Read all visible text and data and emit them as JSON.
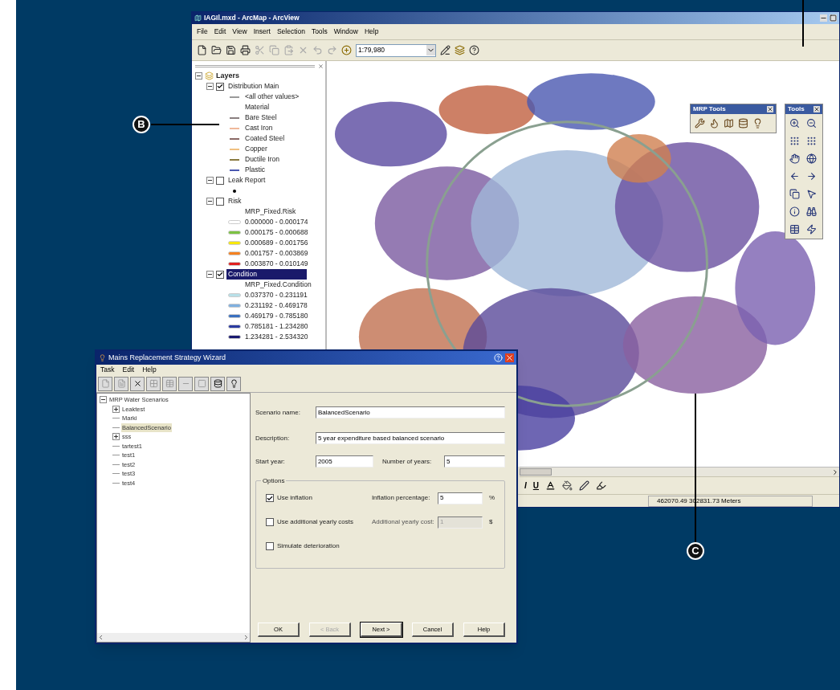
{
  "arcmap": {
    "title": "IAGIl.mxd - ArcMap - ArcView",
    "menu": [
      "File",
      "Edit",
      "View",
      "Insert",
      "Selection",
      "Tools",
      "Window",
      "Help"
    ],
    "scale": "1:79,980",
    "toc": {
      "root": "Layers",
      "expanded": true,
      "layers": [
        {
          "label": "Distribution Main",
          "checked": true,
          "expanded": true,
          "selected": false,
          "legend": [
            {
              "kind": "line",
              "label": "<all other values>",
              "color": "#9a9a9a"
            },
            {
              "kind": "text",
              "label": "Material"
            },
            {
              "kind": "line",
              "label": "Bare Steel",
              "color": "#8a7f80"
            },
            {
              "kind": "line",
              "label": "Cast Iron",
              "color": "#f0b89a"
            },
            {
              "kind": "line",
              "label": "Coated Steel",
              "color": "#8a6a66"
            },
            {
              "kind": "line",
              "label": "Copper",
              "color": "#f0c080"
            },
            {
              "kind": "line",
              "label": "Ductile Iron",
              "color": "#8a7a40"
            },
            {
              "kind": "line",
              "label": "Plastic",
              "color": "#4a58b0"
            }
          ]
        },
        {
          "label": "Leak Report",
          "checked": false,
          "expanded": true,
          "selected": false,
          "legend": [
            {
              "kind": "point",
              "color": "#000000"
            }
          ]
        },
        {
          "label": "Risk",
          "checked": false,
          "expanded": true,
          "selected": false,
          "legend": [
            {
              "kind": "text",
              "label": "MRP_Fixed.Risk"
            },
            {
              "kind": "patch",
              "label": "0.000000 - 0.000174",
              "color": "#ffffff"
            },
            {
              "kind": "patch",
              "label": "0.000175 - 0.000688",
              "color": "#7cc242"
            },
            {
              "kind": "patch",
              "label": "0.000689 - 0.001756",
              "color": "#f7e70a"
            },
            {
              "kind": "patch",
              "label": "0.001757 - 0.003869",
              "color": "#f58220"
            },
            {
              "kind": "patch",
              "label": "0.003870 - 0.010149",
              "color": "#e02020"
            }
          ]
        },
        {
          "label": "Condition",
          "checked": true,
          "expanded": true,
          "selected": true,
          "legend": [
            {
              "kind": "text",
              "label": "MRP_Fixed.Condition"
            },
            {
              "kind": "patch",
              "label": "0.037370 - 0.231191",
              "color": "#b8e0e8"
            },
            {
              "kind": "patch",
              "label": "0.231192 - 0.469178",
              "color": "#80b0e0"
            },
            {
              "kind": "patch",
              "label": "0.469179 - 0.785180",
              "color": "#3a70c0"
            },
            {
              "kind": "patch",
              "label": "0.785181 - 1.234280",
              "color": "#2a3aa0"
            },
            {
              "kind": "patch",
              "label": "1.234281 - 2.534320",
              "color": "#1a1a70"
            }
          ]
        }
      ]
    },
    "toolbars": [
      {
        "title": "MRP Tools"
      },
      {
        "title": "Tools"
      }
    ],
    "format_buttons": [
      "I",
      "U"
    ],
    "status": "462070.49 302831.73 Meters"
  },
  "wizard": {
    "title": "Mains Replacement Strategy Wizard",
    "menu": [
      "Task",
      "Edit",
      "Help"
    ],
    "tree": {
      "label": "MRP Water Scenarios",
      "expanded": true,
      "children": [
        {
          "label": "Leaktest",
          "expanded": false,
          "selected": false
        },
        {
          "label": "Marki",
          "selected": false
        },
        {
          "label": "BalancedScenario",
          "selected": true
        },
        {
          "label": "sss",
          "expanded": false,
          "selected": false
        },
        {
          "label": "tartest1",
          "selected": false
        },
        {
          "label": "test1",
          "selected": false
        },
        {
          "label": "test2",
          "selected": false
        },
        {
          "label": "test3",
          "selected": false
        },
        {
          "label": "test4",
          "selected": false
        }
      ]
    },
    "scenario_name": {
      "label": "Scenario name:",
      "value": "BalancedScenario"
    },
    "description": {
      "label": "Description:",
      "value": "5 year expenditure based balanced scenario"
    },
    "start_year": {
      "label": "Start year:",
      "value": "2005"
    },
    "number_of_years": {
      "label": "Number of years:",
      "value": "5"
    },
    "options": {
      "title": "Options",
      "rows": [
        {
          "label": "Use inflation",
          "checked": true,
          "field_label": "Inflation percentage:",
          "field_value": "5",
          "field_disabled": false,
          "unit": "%"
        },
        {
          "label": "Use additional yearly costs",
          "checked": false,
          "field_label": "Additional yearly cost:",
          "field_value": "1",
          "field_disabled": true,
          "unit": "$"
        },
        {
          "label": "Simulate deterioration",
          "checked": false
        }
      ]
    },
    "buttons": [
      {
        "label": "OK",
        "disabled": false,
        "default": false
      },
      {
        "label": "< Back",
        "disabled": true,
        "default": false
      },
      {
        "label": "Next >",
        "disabled": false,
        "default": true
      },
      {
        "label": "Cancel",
        "disabled": false,
        "default": false
      },
      {
        "label": "Help",
        "disabled": false,
        "default": false
      }
    ]
  },
  "callouts": [
    "B",
    "C"
  ]
}
